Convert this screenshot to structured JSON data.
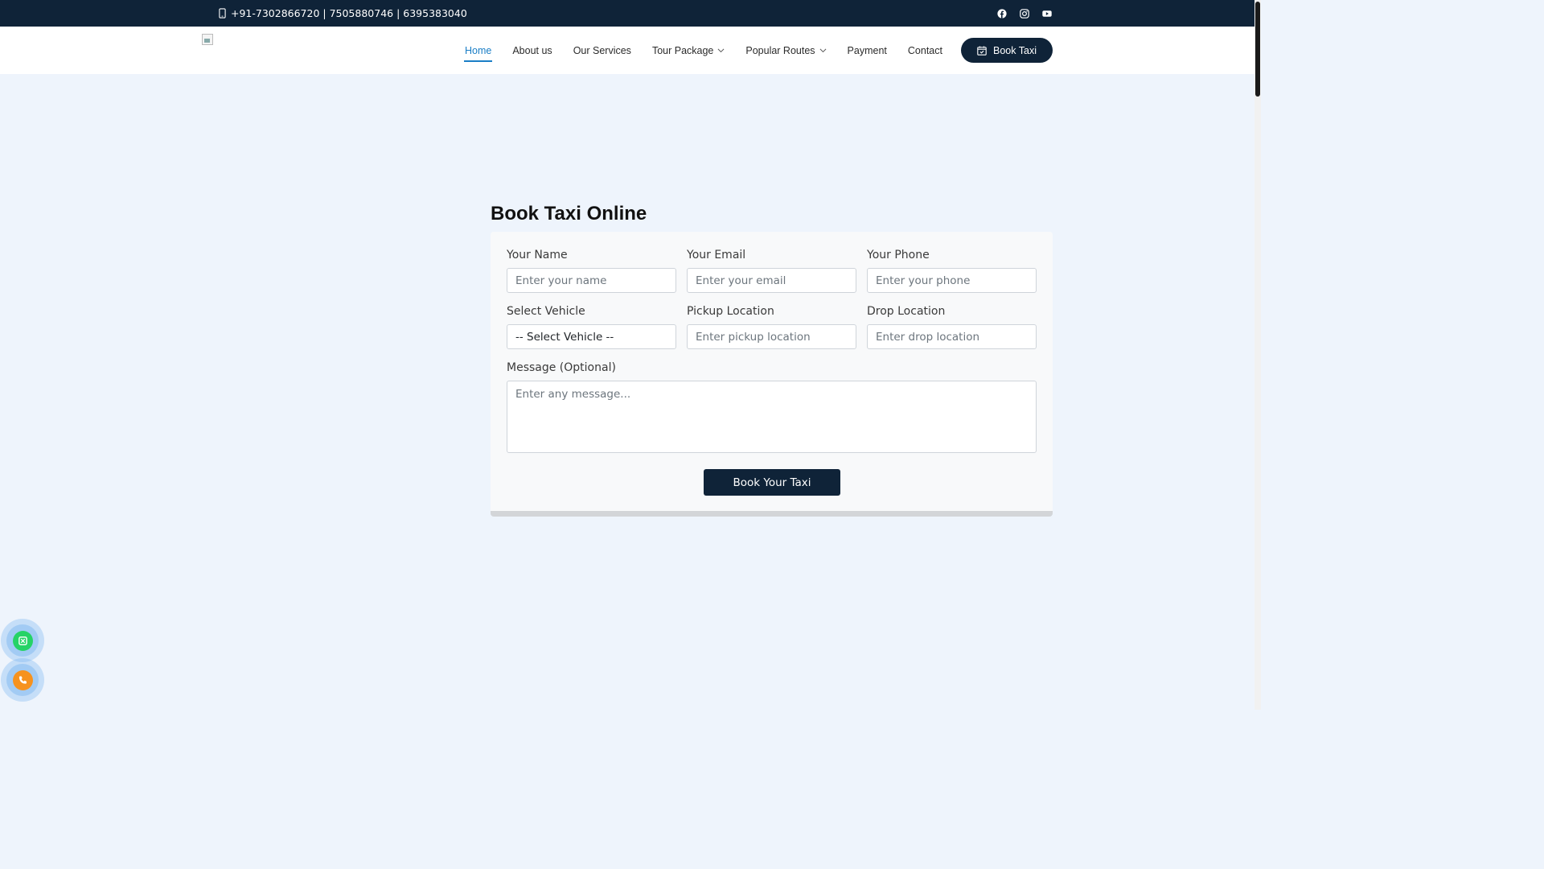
{
  "topbar": {
    "phones": "+91-7302866720 | 7505880746 | 6395383040",
    "social_icons": [
      "facebook-icon",
      "instagram-icon",
      "youtube-icon"
    ]
  },
  "nav": {
    "items": [
      {
        "label": "Home",
        "active": true,
        "dropdown": false
      },
      {
        "label": "About us",
        "active": false,
        "dropdown": false
      },
      {
        "label": "Our Services",
        "active": false,
        "dropdown": false
      },
      {
        "label": "Tour Package",
        "active": false,
        "dropdown": true
      },
      {
        "label": "Popular Routes",
        "active": false,
        "dropdown": true
      },
      {
        "label": "Payment",
        "active": false,
        "dropdown": false
      },
      {
        "label": "Contact",
        "active": false,
        "dropdown": false
      }
    ],
    "book_button": "Book Taxi"
  },
  "booking": {
    "title": "Book Taxi Online",
    "name_label": "Your Name",
    "name_placeholder": "Enter your name",
    "email_label": "Your Email",
    "email_placeholder": "Enter your email",
    "phone_label": "Your Phone",
    "phone_placeholder": "Enter your phone",
    "vehicle_label": "Select Vehicle",
    "vehicle_value": "-- Select Vehicle --",
    "pickup_label": "Pickup Location",
    "pickup_placeholder": "Enter pickup location",
    "drop_label": "Drop Location",
    "drop_placeholder": "Enter drop location",
    "message_label": "Message (Optional)",
    "message_placeholder": "Enter any message...",
    "submit": "Book Your Taxi"
  },
  "colors": {
    "navy": "#0f2338",
    "accent": "#1a7ec6",
    "page_bg": "#eef4fc",
    "whatsapp": "#25d366",
    "call": "#f6921e"
  },
  "floating": [
    "whatsapp-icon",
    "phone-icon"
  ]
}
